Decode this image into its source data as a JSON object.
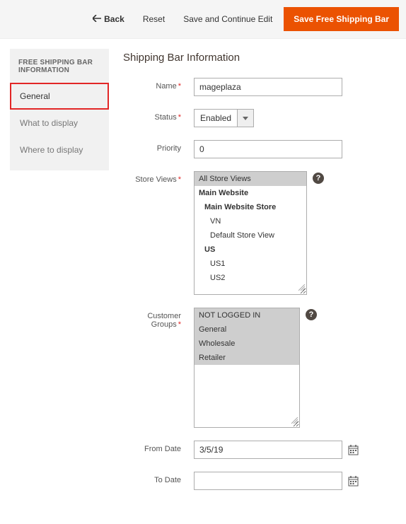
{
  "topbar": {
    "back": "Back",
    "reset": "Reset",
    "save_continue": "Save and Continue Edit",
    "save": "Save Free Shipping Bar"
  },
  "sidebar": {
    "title": "FREE SHIPPING BAR INFORMATION",
    "items": [
      {
        "label": "General"
      },
      {
        "label": "What to display"
      },
      {
        "label": "Where to display"
      }
    ]
  },
  "section": {
    "title": "Shipping Bar Information"
  },
  "fields": {
    "name_label": "Name",
    "name_value": "mageplaza",
    "status_label": "Status",
    "status_value": "Enabled",
    "priority_label": "Priority",
    "priority_value": "0",
    "store_views_label": "Store Views",
    "customer_groups_label": "Customer Groups",
    "from_date_label": "From Date",
    "from_date_value": "3/5/19",
    "to_date_label": "To Date",
    "to_date_value": ""
  },
  "store_views": {
    "all": "All Store Views",
    "main_website": "Main Website",
    "main_website_store": "Main Website Store",
    "vn": "VN",
    "default_store_view": "Default Store View",
    "us": "US",
    "us1": "US1",
    "us2": "US2"
  },
  "customer_groups": {
    "not_logged_in": "NOT LOGGED IN",
    "general": "General",
    "wholesale": "Wholesale",
    "retailer": "Retailer"
  }
}
